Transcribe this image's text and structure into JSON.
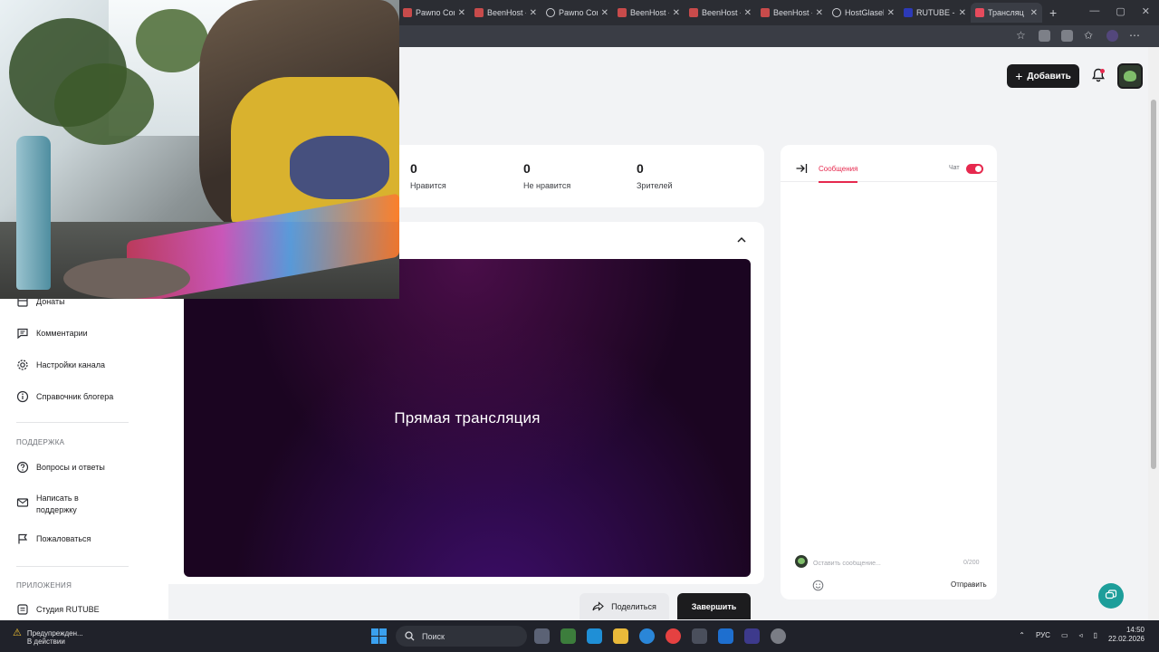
{
  "browser": {
    "tabs": [
      {
        "label": "Pawno Con",
        "icon": "pawno-icon"
      },
      {
        "label": "BeenHost -",
        "icon": "beenhost-icon"
      },
      {
        "label": "Pawno Con",
        "icon": "globe-icon"
      },
      {
        "label": "BeenHost -",
        "icon": "beenhost-icon"
      },
      {
        "label": "BeenHost -",
        "icon": "beenhost-icon"
      },
      {
        "label": "BeenHost -",
        "icon": "beenhost-icon"
      },
      {
        "label": "HostGlasel",
        "icon": "globe-icon"
      },
      {
        "label": "RUTUBE - c",
        "icon": "rutube-icon"
      },
      {
        "label": "Трансляц",
        "icon": "studio-icon"
      }
    ],
    "new_tab": "+"
  },
  "header": {
    "add_label": "Добавить"
  },
  "sidebar": {
    "items": [
      {
        "label": "Донаты",
        "icon": "donate-icon"
      },
      {
        "label": "Комментарии",
        "icon": "comment-icon"
      },
      {
        "label": "Настройки канала",
        "icon": "gear-icon"
      },
      {
        "label": "Справочник блогера",
        "icon": "info-icon"
      }
    ],
    "support_heading": "ПОДДЕРЖКА",
    "support_items": [
      {
        "label": "Вопросы и ответы",
        "icon": "question-icon"
      },
      {
        "label": "Написать в поддержку",
        "icon": "mail-icon"
      },
      {
        "label": "Пожаловаться",
        "icon": "flag-icon"
      }
    ],
    "apps_heading": "ПРИЛОЖЕНИЯ",
    "apps_items": [
      {
        "label": "Студия RUTUBE",
        "icon": "studio-app-icon"
      }
    ]
  },
  "stats": [
    {
      "value": "0",
      "caption": "Нравится"
    },
    {
      "value": "0",
      "caption": "Не нравится"
    },
    {
      "value": "0",
      "caption": "Зрителей"
    }
  ],
  "preview": {
    "title": "Прямая трансляция",
    "share_label": "Поделиться",
    "finish_label": "Завершить"
  },
  "chat": {
    "tab_label": "Сообщения",
    "toggle_label": "Чат",
    "toggle_on": true,
    "input_placeholder": "Оставить сообщение...",
    "counter": "0/200",
    "send_label": "Отправить"
  },
  "taskbar": {
    "warning_title": "Предупрежден...",
    "warning_sub": "В действии",
    "search_placeholder": "Поиск",
    "lang": "РУС",
    "time": "14:50",
    "date": "22.02.2026"
  },
  "colors": {
    "accent": "#e6294e",
    "primary_button": "#1c1c1e",
    "help_fab": "#1d9e9a"
  }
}
